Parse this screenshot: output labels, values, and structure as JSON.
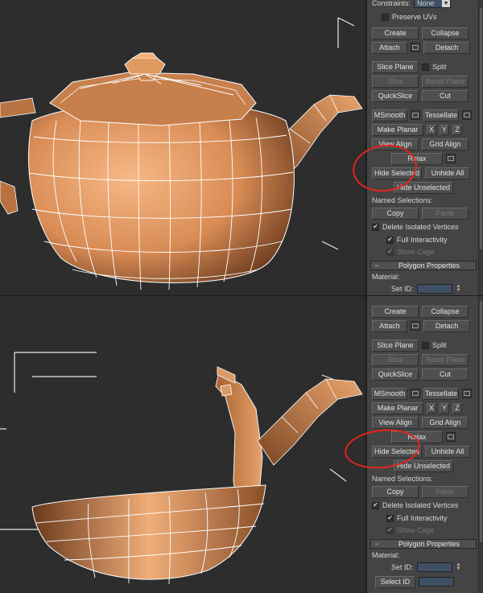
{
  "top_panel": {
    "constraints_label": "Constraints:",
    "constraints_value": "None",
    "preserve_uvs": "Preserve UVs",
    "create": "Create",
    "collapse": "Collapse",
    "attach": "Attach",
    "detach": "Detach",
    "slice_plane": "Slice Plane",
    "split": "Split",
    "slice": "Slice",
    "reset_plane": "Reset Plane",
    "quickslice": "QuickSlice",
    "cut": "Cut",
    "msmooth": "MSmooth",
    "tessellate": "Tessellate",
    "make_planar": "Make Planar",
    "x": "X",
    "y": "Y",
    "z": "Z",
    "view_align": "View Align",
    "grid_align": "Grid Align",
    "relax": "Relax",
    "hide_selected": "Hide Selected",
    "unhide_all": "Unhide All",
    "hide_unselected": "Hide Unselected",
    "named_selections": "Named Selections:",
    "copy": "Copy",
    "paste": "Paste",
    "delete_isolated": "Delete Isolated Vertices",
    "full_interactivity": "Full Interactivity",
    "show_cage": "Show Cage",
    "rollout_title": "Polygon Properties",
    "material": "Material:",
    "set_id": "Set ID:"
  },
  "bottom_panel": {
    "create": "Create",
    "collapse": "Collapse",
    "attach": "Attach",
    "detach": "Detach",
    "slice_plane": "Slice Plane",
    "split": "Split",
    "slice": "Slice",
    "reset_plane": "Reset Plane",
    "quickslice": "QuickSlice",
    "cut": "Cut",
    "msmooth": "MSmooth",
    "tessellate": "Tessellate",
    "make_planar": "Make Planar",
    "x": "X",
    "y": "Y",
    "z": "Z",
    "view_align": "View Align",
    "grid_align": "Grid Align",
    "relax": "Relax",
    "hide_selected": "Hide Selected",
    "unhide_all": "Unhide All",
    "hide_unselected": "Hide Unselected",
    "named_selections": "Named Selections:",
    "copy": "Copy",
    "paste": "Paste",
    "delete_isolated": "Delete Isolated Vertices",
    "full_interactivity": "Full Interactivity",
    "show_cage": "Show Cage",
    "rollout_title": "Polygon Properties",
    "material": "Material:",
    "set_id": "Set ID:",
    "select_id": "Select ID"
  },
  "colors": {
    "viewport_bg": "#2d2d2d",
    "panel_bg": "#444444",
    "mesh_fill": "#e29a63",
    "wireframe": "#ffffff",
    "annotation": "#e3241f"
  }
}
